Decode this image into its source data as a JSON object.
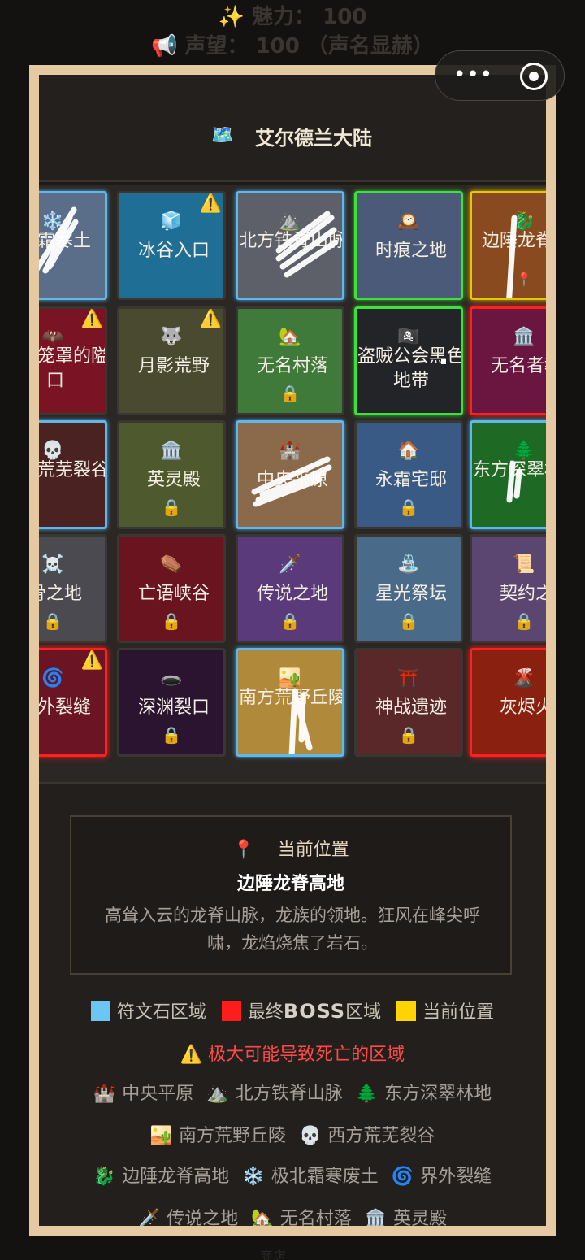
{
  "background": {
    "stat1": "✨  魅力：  100",
    "stat2": "📢  声望：  100  （声名显赫）",
    "footer": "商店"
  },
  "capsule": {
    "menu_dots": "•••"
  },
  "map": {
    "title_icon": "🗺️",
    "title": "艾尔德兰大陆",
    "tiles": [
      {
        "icon": "❄️",
        "name": "北霜寒土",
        "type": "rune",
        "locked": false,
        "warn": false
      },
      {
        "icon": "🧊",
        "name": "冰谷入口",
        "type": "normal",
        "locked": false,
        "warn": true
      },
      {
        "icon": "⛰️",
        "name": "北方铁脊山脉",
        "type": "rune",
        "locked": false,
        "warn": false
      },
      {
        "icon": "🕰️",
        "name": "时痕之地",
        "type": "green",
        "locked": false,
        "warn": false
      },
      {
        "icon": "🐉",
        "name": "边陲龙脊地",
        "type": "current",
        "locked": false,
        "warn": false,
        "pin": "📍"
      },
      {
        "icon": "🦇",
        "name": "血雾笼罩的隘口",
        "type": "normal",
        "locked": false,
        "warn": true
      },
      {
        "icon": "🐺",
        "name": "月影荒野",
        "type": "normal",
        "locked": false,
        "warn": true
      },
      {
        "icon": "🏡",
        "name": "无名村落",
        "type": "normal",
        "locked": true,
        "warn": false
      },
      {
        "icon": "🏴‍☠️",
        "name": "盗贼公会黑色地带",
        "type": "green",
        "locked": false,
        "warn": false
      },
      {
        "icon": "🏛️",
        "name": "无名者教",
        "type": "boss",
        "locked": false,
        "warn": false
      },
      {
        "icon": "💀",
        "name": "西方荒芜裂谷",
        "type": "rune",
        "locked": false,
        "warn": false
      },
      {
        "icon": "🏛️",
        "name": "英灵殿",
        "type": "normal",
        "locked": true,
        "warn": false
      },
      {
        "icon": "🏰",
        "name": "中央平原",
        "type": "rune",
        "locked": false,
        "warn": false
      },
      {
        "icon": "🏠",
        "name": "永霜宅邸",
        "type": "normal",
        "locked": true,
        "warn": false
      },
      {
        "icon": "🌲",
        "name": "东方深翠林地",
        "type": "rune",
        "locked": false,
        "warn": false
      },
      {
        "icon": "☠️",
        "name": "骨之地",
        "type": "normal",
        "locked": true,
        "warn": false
      },
      {
        "icon": "⚰️",
        "name": "亡语峡谷",
        "type": "normal",
        "locked": true,
        "warn": false
      },
      {
        "icon": "🗡️",
        "name": "传说之地",
        "type": "normal",
        "locked": true,
        "warn": false
      },
      {
        "icon": "⛲",
        "name": "星光祭坛",
        "type": "normal",
        "locked": true,
        "warn": false
      },
      {
        "icon": "📜",
        "name": "契约之",
        "type": "normal",
        "locked": true,
        "warn": false
      },
      {
        "icon": "🌀",
        "name": "界外裂缝",
        "type": "boss",
        "locked": false,
        "warn": true
      },
      {
        "icon": "🕳️",
        "name": "深渊裂口",
        "type": "normal",
        "locked": true,
        "warn": false
      },
      {
        "icon": "🏜️",
        "name": "南方荒野丘陵",
        "type": "rune",
        "locked": false,
        "warn": false
      },
      {
        "icon": "⛩️",
        "name": "神战遗迹",
        "type": "normal",
        "locked": true,
        "warn": false
      },
      {
        "icon": "🌋",
        "name": "灰烬火",
        "type": "boss",
        "locked": false,
        "warn": false
      }
    ],
    "lock_icon": "🔒",
    "warn_icon": "⚠️"
  },
  "info": {
    "label_icon": "📍",
    "label": "当前位置",
    "name": "边陲龙脊高地",
    "desc": "高耸入云的龙脊山脉，龙族的领地。狂风在峰尖呼啸，龙焰烧焦了岩石。"
  },
  "legend": {
    "rune": "符文石区域",
    "rune_color": "#6cc6f5",
    "boss_prefix": "最终",
    "boss_word": "BOSS",
    "boss_suffix": "区域",
    "boss_color": "#ff1c1c",
    "current": "当前位置",
    "current_color": "#ffd400",
    "danger": "⚠️ 极大可能导致死亡的区域",
    "regions_row1": [
      {
        "icon": "🏰",
        "label": "中央平原"
      },
      {
        "icon": "⛰️",
        "label": "北方铁脊山脉"
      },
      {
        "icon": "🌲",
        "label": "东方深翠林地"
      }
    ],
    "regions_row2": [
      {
        "icon": "🏜️",
        "label": "南方荒野丘陵"
      },
      {
        "icon": "💀",
        "label": "西方荒芜裂谷"
      }
    ],
    "regions_row3": [
      {
        "icon": "🐉",
        "label": "边陲龙脊高地"
      },
      {
        "icon": "❄️",
        "label": "极北霜寒废土"
      },
      {
        "icon": "🌀",
        "label": "界外裂缝"
      }
    ],
    "regions_row4": [
      {
        "icon": "🗡️",
        "label": "传说之地"
      },
      {
        "icon": "🏡",
        "label": "无名村落"
      },
      {
        "icon": "🏛️",
        "label": "英灵殿"
      }
    ]
  }
}
